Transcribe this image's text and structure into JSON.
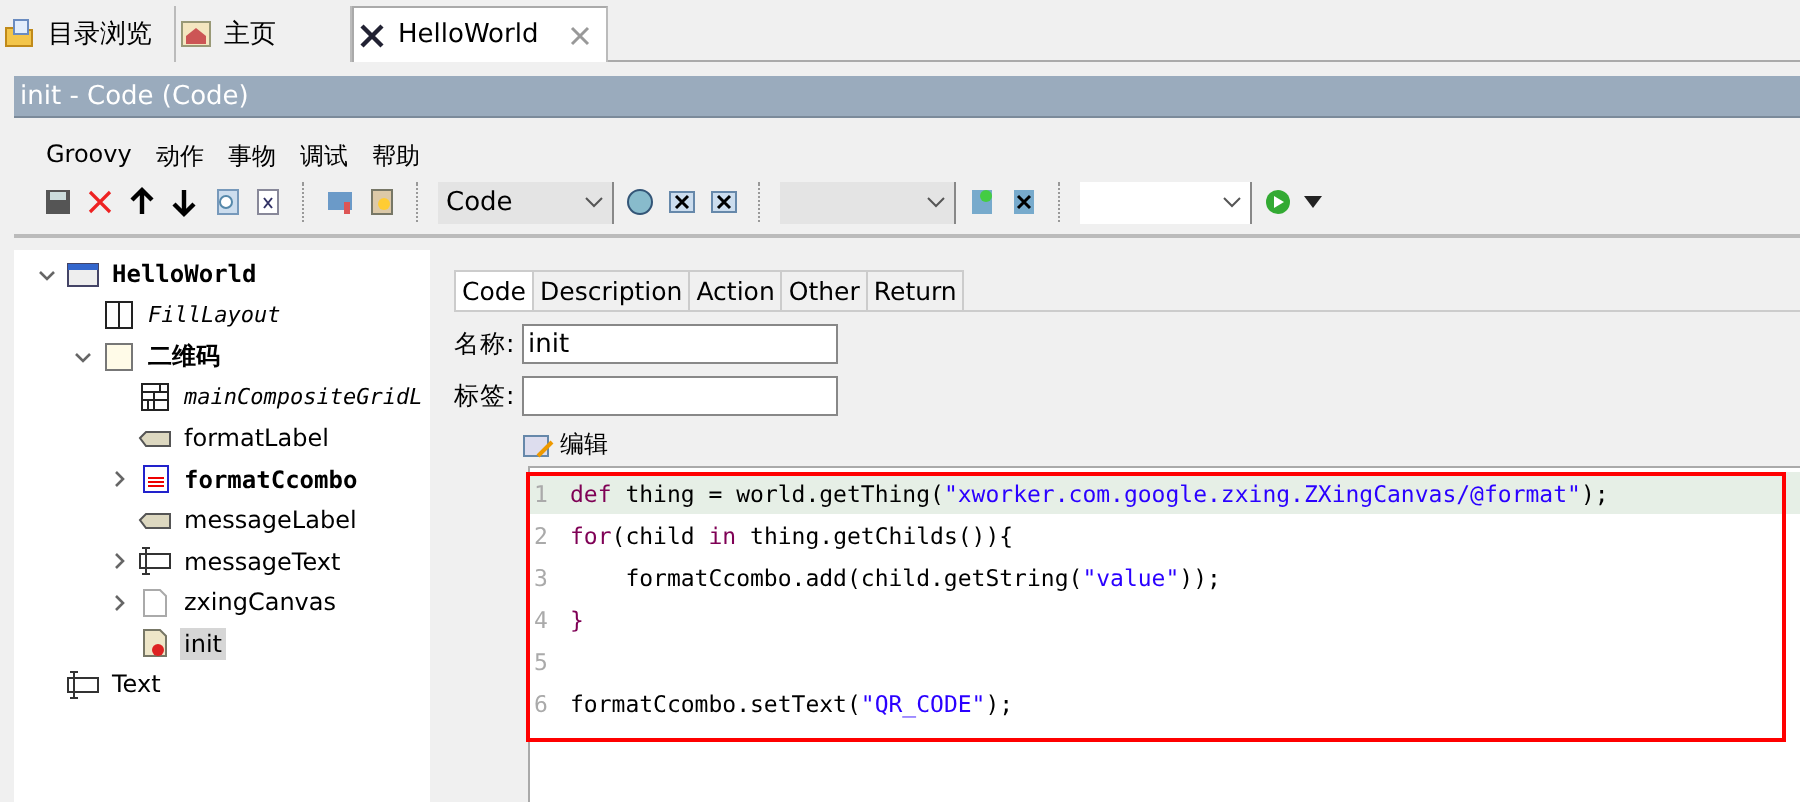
{
  "tabs": [
    {
      "label": "目录浏览",
      "kind": "folder",
      "selected": false,
      "closable": false
    },
    {
      "label": "主页",
      "kind": "home",
      "selected": false,
      "closable": false
    },
    {
      "label": "HelloWorld",
      "kind": "thing",
      "selected": true,
      "closable": true
    }
  ],
  "panel_title": "init - Code  (Code)",
  "menu": [
    "Groovy",
    "动作",
    "事物",
    "调试",
    "帮助"
  ],
  "toolbar": {
    "combo_1": "Code"
  },
  "tree": [
    {
      "label": "HelloWorld",
      "kind": "window",
      "expanded": true,
      "selected": false,
      "children": [
        {
          "label": "FillLayout",
          "kind": "layout",
          "selected": false
        },
        {
          "label": "二维码",
          "kind": "composite",
          "expanded": true,
          "selected": false,
          "children": [
            {
              "label": "mainCompositeGridL",
              "kind": "grid",
              "selected": false
            },
            {
              "label": "formatLabel",
              "kind": "label",
              "selected": false
            },
            {
              "label": "formatCcombo",
              "kind": "combo",
              "expanded": false,
              "selected": false
            },
            {
              "label": "messageLabel",
              "kind": "label",
              "selected": false
            },
            {
              "label": "messageText",
              "kind": "text",
              "expanded": false,
              "selected": false
            },
            {
              "label": "zxingCanvas",
              "kind": "canvas",
              "expanded": false,
              "selected": false
            },
            {
              "label": "init",
              "kind": "script",
              "selected": true
            }
          ]
        }
      ]
    },
    {
      "label": "Text",
      "kind": "text",
      "selected": false
    }
  ],
  "editor_tabs": [
    {
      "label": "Code",
      "selected": true
    },
    {
      "label": "Description",
      "selected": false
    },
    {
      "label": "Action",
      "selected": false
    },
    {
      "label": "Other",
      "selected": false
    },
    {
      "label": "Return",
      "selected": false
    }
  ],
  "fields": [
    {
      "label": "名称:",
      "value": "init"
    },
    {
      "label": "标签:"
    }
  ],
  "edit_button": "编辑",
  "code_lines": [
    {
      "number": "1",
      "current": true,
      "tokens": [
        {
          "kind": "keyword",
          "text": "def"
        },
        {
          "kind": "plain",
          "text": " thing = world.getThing("
        },
        {
          "kind": "string",
          "text": "\"xworker.com.google.zxing.ZXingCanvas/@format\""
        },
        {
          "kind": "plain",
          "text": ");"
        }
      ]
    },
    {
      "number": "2",
      "current": false,
      "tokens": [
        {
          "kind": "keyword",
          "text": "for"
        },
        {
          "kind": "plain",
          "text": "(child "
        },
        {
          "kind": "keyword",
          "text": "in"
        },
        {
          "kind": "plain",
          "text": " thing.getChilds()){"
        }
      ]
    },
    {
      "number": "3",
      "current": false,
      "tokens": [
        {
          "kind": "plain",
          "text": "    formatCcombo.add(child.getString("
        },
        {
          "kind": "string",
          "text": "\"value\""
        },
        {
          "kind": "plain",
          "text": "));"
        }
      ]
    },
    {
      "number": "4",
      "current": false,
      "tokens": [
        {
          "kind": "keyword",
          "text": "}"
        }
      ]
    },
    {
      "number": "5",
      "current": false
    },
    {
      "number": "6",
      "current": false,
      "tokens": [
        {
          "kind": "plain",
          "text": "formatCcombo.setText("
        },
        {
          "kind": "string",
          "text": "\"QR_CODE\""
        },
        {
          "kind": "plain",
          "text": ");"
        }
      ]
    }
  ]
}
